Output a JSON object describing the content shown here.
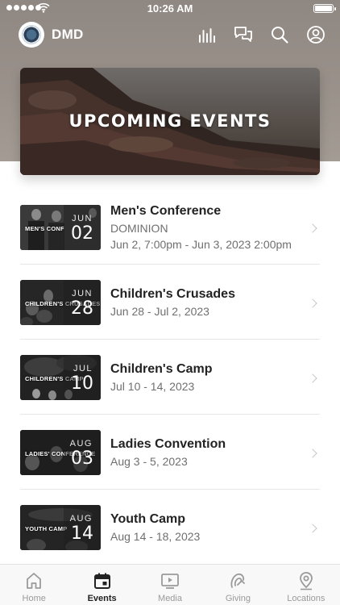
{
  "status_bar": {
    "time": "10:26 AM"
  },
  "app_bar": {
    "brand": "DMD",
    "icons": [
      "bars-chart-icon",
      "chat-bubbles-icon",
      "search-icon",
      "profile-icon"
    ]
  },
  "hero": {
    "title": "UPCOMING EVENTS"
  },
  "events": [
    {
      "title": "Men's Conference",
      "subtitle1": "DOMINION",
      "subtitle2": "Jun 2, 7:00pm - Jun 3, 2023 2:00pm",
      "month": "JUN",
      "day": "02",
      "thumb_tag": "MEN'S CONF"
    },
    {
      "title": "Children's Crusades",
      "subtitle1": "Jun 28 - Jul 2, 2023",
      "month": "JUN",
      "day": "28",
      "thumb_tag": "CHILDREN'S CRUSADES"
    },
    {
      "title": "Children's Camp",
      "subtitle1": "Jul 10 - 14, 2023",
      "month": "JUL",
      "day": "10",
      "thumb_tag": "CHILDREN'S CAMP"
    },
    {
      "title": "Ladies Convention",
      "subtitle1": "Aug 3 - 5, 2023",
      "month": "AUG",
      "day": "03",
      "thumb_tag": "LADIES' CONFERENCE"
    },
    {
      "title": "Youth Camp",
      "subtitle1": "Aug 14 - 18, 2023",
      "month": "AUG",
      "day": "14",
      "thumb_tag": "YOUTH CAMP"
    }
  ],
  "tabs": [
    {
      "label": "Home",
      "icon": "home-icon",
      "active": false
    },
    {
      "label": "Events",
      "icon": "calendar-icon",
      "active": true
    },
    {
      "label": "Media",
      "icon": "play-icon",
      "active": false
    },
    {
      "label": "Giving",
      "icon": "giving-icon",
      "active": false
    },
    {
      "label": "Locations",
      "icon": "location-pin-icon",
      "active": false
    }
  ],
  "colors": {
    "header_bg": "#9a928b",
    "active_tab": "#222222",
    "inactive_tab": "#9a9a9a"
  }
}
